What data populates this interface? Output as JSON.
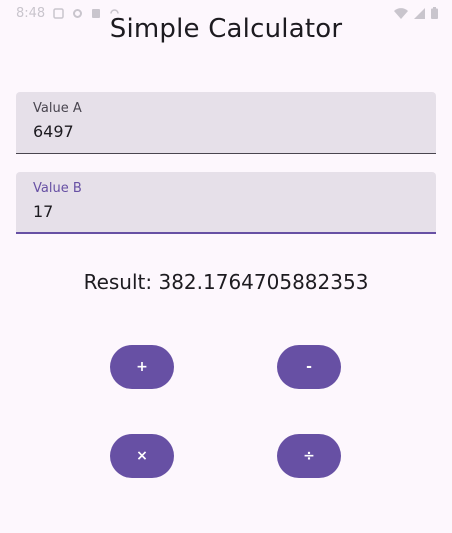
{
  "status_bar": {
    "time": "8:48",
    "left_icons": [
      "sim-icon",
      "settings-icon",
      "battery-saver-icon",
      "sync-icon"
    ],
    "right_icons": [
      "wifi-icon",
      "signal-icon",
      "battery-icon"
    ]
  },
  "app": {
    "title": "Simple Calculator"
  },
  "inputs": {
    "value_a": {
      "label": "Value A",
      "value": "6497"
    },
    "value_b": {
      "label": "Value B",
      "value": "17"
    }
  },
  "result": {
    "text": "Result: 382.1764705882353"
  },
  "operators": {
    "add": "+",
    "subtract": "-",
    "multiply": "×",
    "divide": "÷"
  },
  "colors": {
    "background": "#fdf7fd",
    "primary": "#6750a4",
    "field_background": "#e6e0e9",
    "on_surface": "#1d1b20"
  }
}
